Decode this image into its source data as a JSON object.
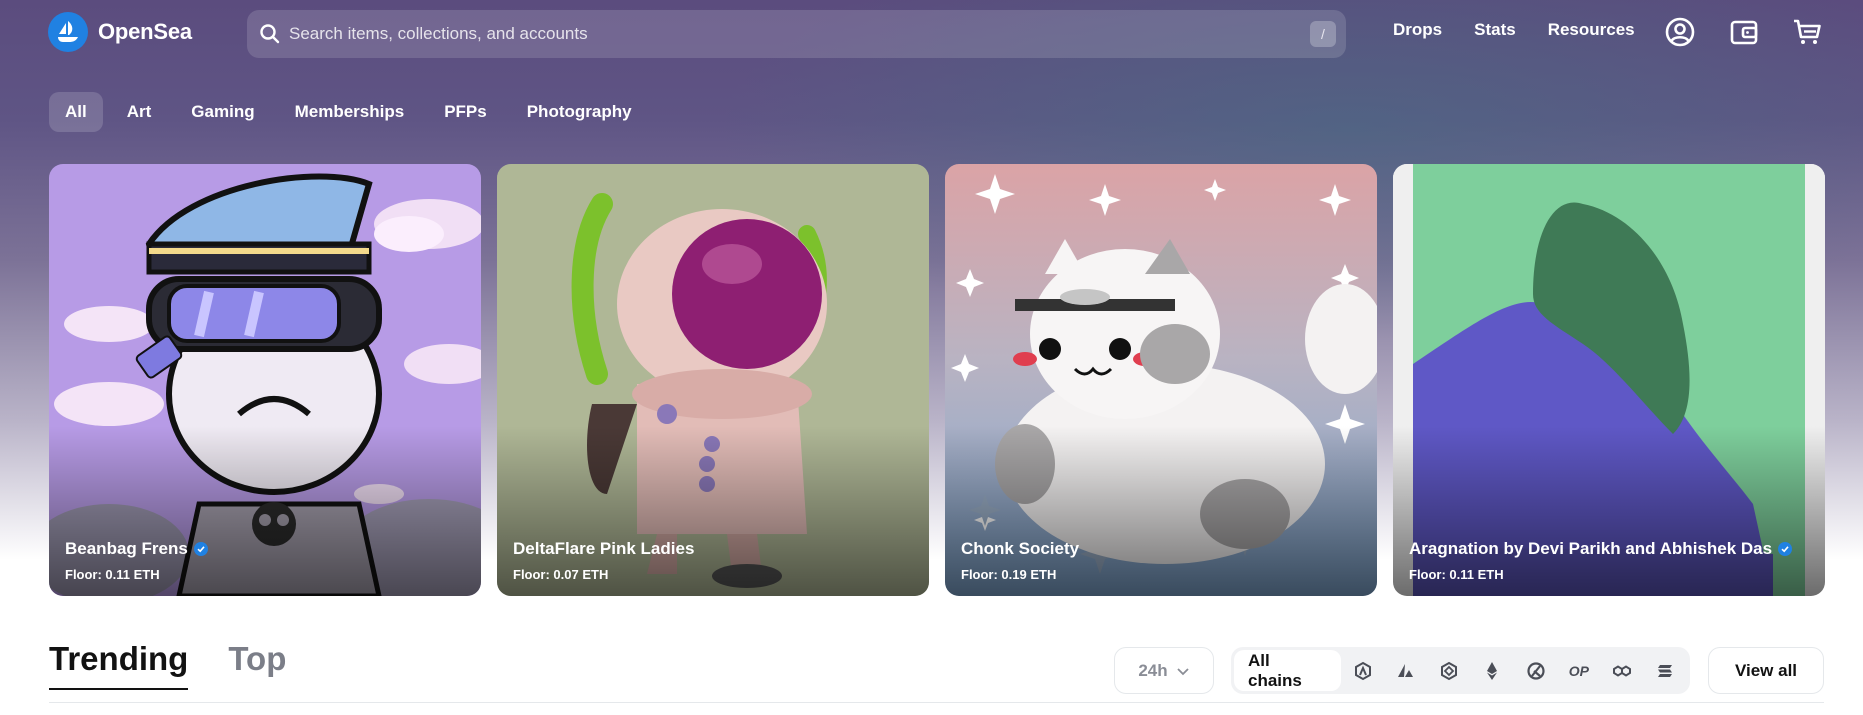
{
  "brand": {
    "name": "OpenSea"
  },
  "search": {
    "placeholder": "Search items, collections, and accounts",
    "shortcut": "/"
  },
  "nav": {
    "links": [
      "Drops",
      "Stats",
      "Resources"
    ],
    "icons": [
      "account-icon",
      "wallet-icon",
      "cart-icon"
    ]
  },
  "categories": {
    "items": [
      "All",
      "Art",
      "Gaming",
      "Memberships",
      "PFPs",
      "Photography"
    ],
    "active": "All"
  },
  "featured": [
    {
      "name": "Beanbag Frens",
      "floor": "Floor: 0.11 ETH",
      "verified": true
    },
    {
      "name": "DeltaFlare Pink Ladies",
      "floor": "Floor: 0.07 ETH",
      "verified": false
    },
    {
      "name": "Chonk Society",
      "floor": "Floor: 0.19 ETH",
      "verified": false
    },
    {
      "name": "Aragnation by Devi Parikh and Abhishek Das",
      "floor": "Floor: 0.11 ETH",
      "verified": true
    }
  ],
  "trending": {
    "tabs": [
      "Trending",
      "Top"
    ],
    "active_tab": "Trending",
    "time_range": "24h",
    "chains_label": "All chains",
    "chain_icons": [
      "arbitrum-icon",
      "avalanche-icon",
      "bnb-icon",
      "ethereum-icon",
      "klaytn-icon",
      "optimism-icon",
      "polygon-icon",
      "solana-icon"
    ],
    "optimism_label": "OP",
    "view_all": "View all"
  },
  "colors": {
    "accent": "#2081e2",
    "verified": "#2081e2"
  }
}
